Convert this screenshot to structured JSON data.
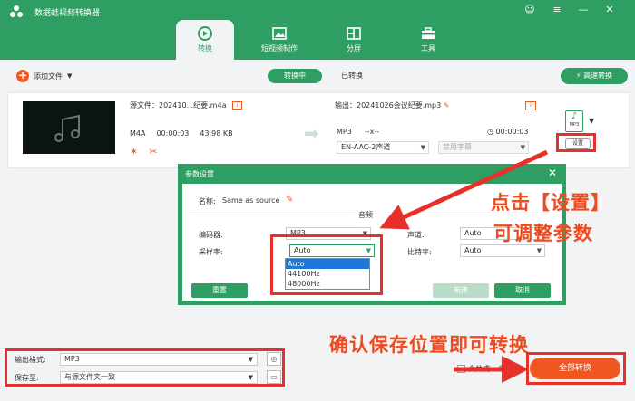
{
  "app": {
    "title": "数据蛙视频转换器",
    "window_controls": [
      "☺",
      "≡",
      "—",
      "✕"
    ]
  },
  "tabs": [
    {
      "label": "转换",
      "icon": "convert-icon",
      "active": true
    },
    {
      "label": "短视频制作",
      "icon": "short-video-icon",
      "active": false
    },
    {
      "label": "分屏",
      "icon": "split-screen-icon",
      "active": false
    },
    {
      "label": "工具",
      "icon": "toolbox-icon",
      "active": false
    }
  ],
  "toolbar": {
    "add_file": "添加文件",
    "converting": "转换中",
    "converted": "已转换",
    "fast_convert": "高速转换"
  },
  "file": {
    "source_label": "源文件：202410...纪要.m4a",
    "format": "M4A",
    "duration": "00:00:03",
    "size": "43.98 KB",
    "output_label": "输出：20241026会议纪要.mp3",
    "output_format": "MP3",
    "resolution": "--x--",
    "output_duration": "00:00:03",
    "audio_track": "EN-AAC-2声道",
    "subtitle": "禁用字幕",
    "format_icon_label": "MP3",
    "settings_button": "设置"
  },
  "dialog": {
    "title": "参数设置",
    "name_label": "名称:",
    "name_value": "Same as source",
    "section": "音频",
    "encoder_label": "编码器:",
    "encoder_value": "MP3",
    "channel_label": "声道:",
    "channel_value": "Auto",
    "samplerate_label": "采样率:",
    "samplerate_value": "Auto",
    "bitrate_label": "比特率:",
    "bitrate_value": "Auto",
    "samplerate_options": [
      "Auto",
      "44100Hz",
      "48000Hz"
    ],
    "reset": "重置",
    "new": "新建",
    "cancel": "取消"
  },
  "bottom": {
    "output_format_label": "输出格式:",
    "output_format_value": "MP3",
    "save_to_label": "保存至:",
    "save_to_value": "与源文件夹一致",
    "merge_label": "合并成一个文件",
    "convert_all": "全部转换"
  },
  "annotations": {
    "settings_hint_1": "点击【设置】",
    "settings_hint_2": "可调整参数",
    "save_hint": "确认保存位置即可转换"
  },
  "colors": {
    "brand_green": "#2f9e62",
    "accent_orange": "#f05a22",
    "annotation_red": "#e8302a"
  }
}
